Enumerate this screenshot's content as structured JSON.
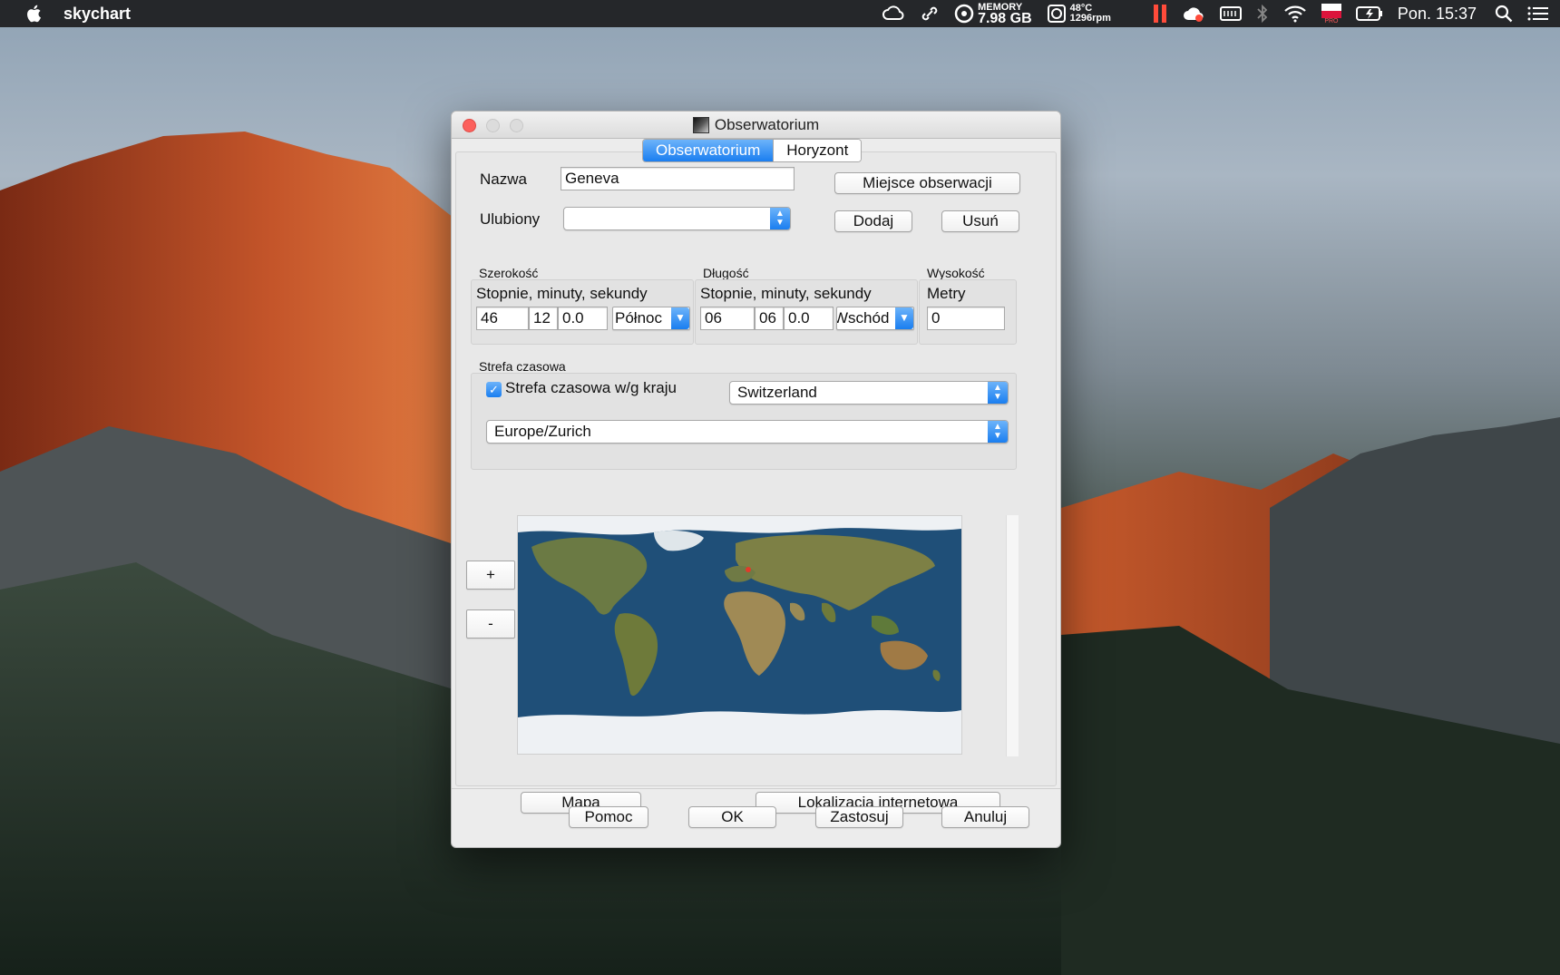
{
  "menubar": {
    "app_name": "skychart",
    "memory_label": "MEMORY",
    "memory_value": "7.98 GB",
    "temp_value": "48°C",
    "fan_value": "1296rpm",
    "flag_label": "PRO",
    "clock": "Pon. 15:37"
  },
  "window": {
    "title": "Obserwatorium",
    "tabs": [
      {
        "label": "Obserwatorium",
        "active": true
      },
      {
        "label": "Horyzont",
        "active": false
      }
    ],
    "name_label": "Nazwa",
    "name_value": "Geneva",
    "observation_place_button": "Miejsce obserwacji",
    "favorite_label": "Ulubiony",
    "favorite_value": "",
    "add_button": "Dodaj",
    "remove_button": "Usuń",
    "latitude": {
      "title": "Szerokość",
      "subtitle": "Stopnie, minuty, sekundy",
      "deg": "46",
      "min": "12",
      "sec": "0.0",
      "hemisphere": "Północ"
    },
    "longitude": {
      "title": "Długość",
      "subtitle": "Stopnie, minuty, sekundy",
      "deg": "06",
      "min": "06",
      "sec": "0.0",
      "hemisphere": "Wschód"
    },
    "altitude": {
      "title": "Wysokość",
      "subtitle": "Metry",
      "value": "0"
    },
    "timezone": {
      "title": "Strefa czasowa",
      "by_country_label": "Strefa czasowa w/g kraju",
      "by_country_checked": true,
      "country": "Switzerland",
      "zone": "Europe/Zurich"
    },
    "zoom_in": "+",
    "zoom_out": "-",
    "map_button": "Mapa",
    "internet_location_button": "Lokalizacja internetowa",
    "footer": {
      "help": "Pomoc",
      "ok": "OK",
      "apply": "Zastosuj",
      "cancel": "Anuluj"
    }
  }
}
